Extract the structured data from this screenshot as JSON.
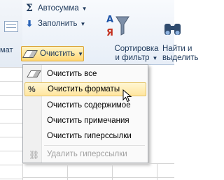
{
  "ribbon": {
    "left_fragment": "мат",
    "autosum_label": "Автосумма",
    "fill_label": "Заполнить",
    "clear_label": "Очистить",
    "sort_filter_line1": "Сортировка",
    "sort_filter_line2": "и фильтр",
    "find_select_line1": "Найти и",
    "find_select_line2": "выделить"
  },
  "clear_menu": {
    "items": [
      {
        "label": "Очистить все",
        "icon": "eraser-icon",
        "state": "normal"
      },
      {
        "label": "Очистить форматы",
        "icon": "percent-eraser-icon",
        "state": "hover"
      },
      {
        "label": "Очистить содержимое",
        "icon": "",
        "state": "normal"
      },
      {
        "label": "Очистить примечания",
        "icon": "",
        "state": "normal"
      },
      {
        "label": "Очистить гиперссылки",
        "icon": "",
        "state": "normal"
      },
      {
        "label": "Удалить гиперссылки",
        "icon": "remove-link-icon",
        "state": "disabled"
      }
    ]
  },
  "colors": {
    "hover_bg": "#ffe6a0",
    "ribbon_text": "#1e395b",
    "disabled_text": "#a0a0a0"
  }
}
